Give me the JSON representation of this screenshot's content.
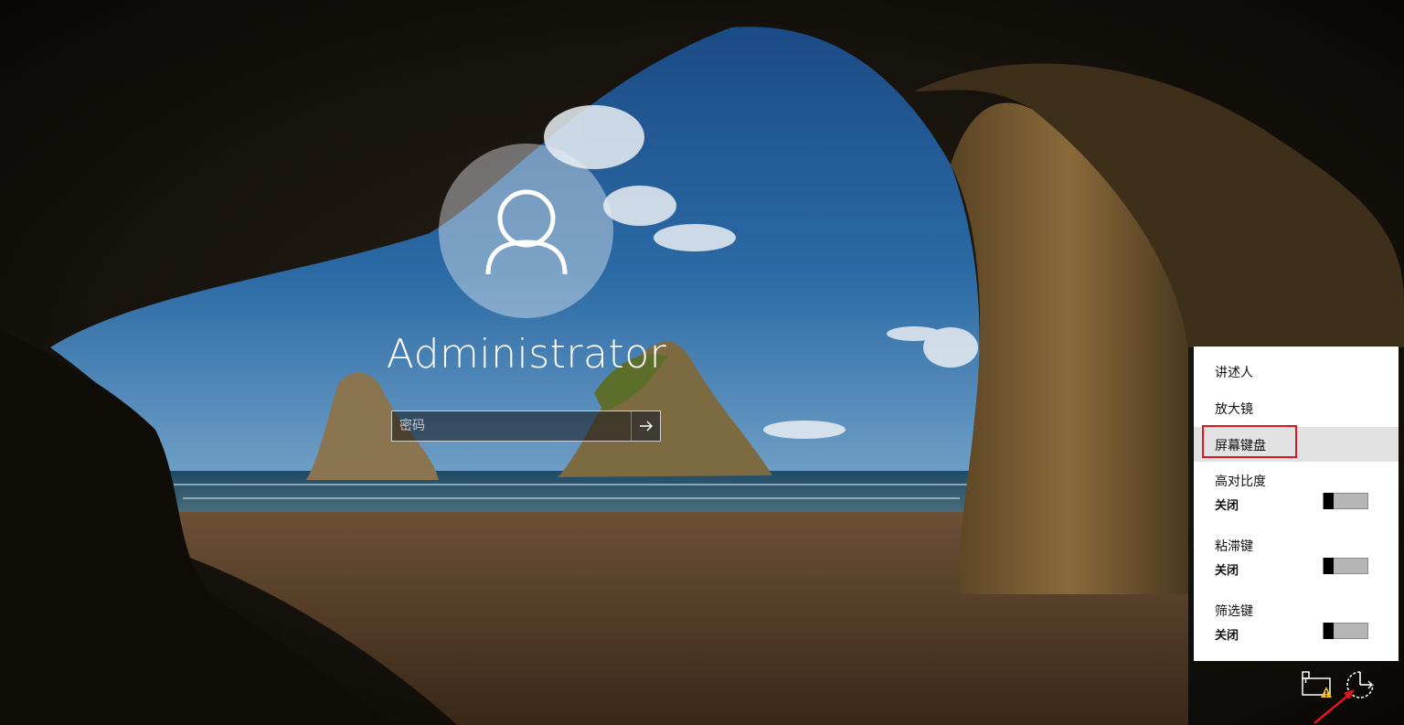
{
  "login": {
    "username": "Administrator",
    "password_placeholder": "密码",
    "password_value": ""
  },
  "ease_menu": {
    "items": [
      {
        "label": "讲述人"
      },
      {
        "label": "放大镜"
      },
      {
        "label": "屏幕键盘",
        "selected": true
      }
    ],
    "toggles": [
      {
        "label": "高对比度",
        "state": "关闭"
      },
      {
        "label": "粘滞键",
        "state": "关闭"
      },
      {
        "label": "筛选键",
        "state": "关闭"
      }
    ]
  },
  "tray": {
    "icons": [
      "network-warning-icon",
      "ease-of-access-icon"
    ]
  },
  "colors": {
    "highlight": "#e1171d",
    "menu_selected": "#e2e2e2"
  }
}
